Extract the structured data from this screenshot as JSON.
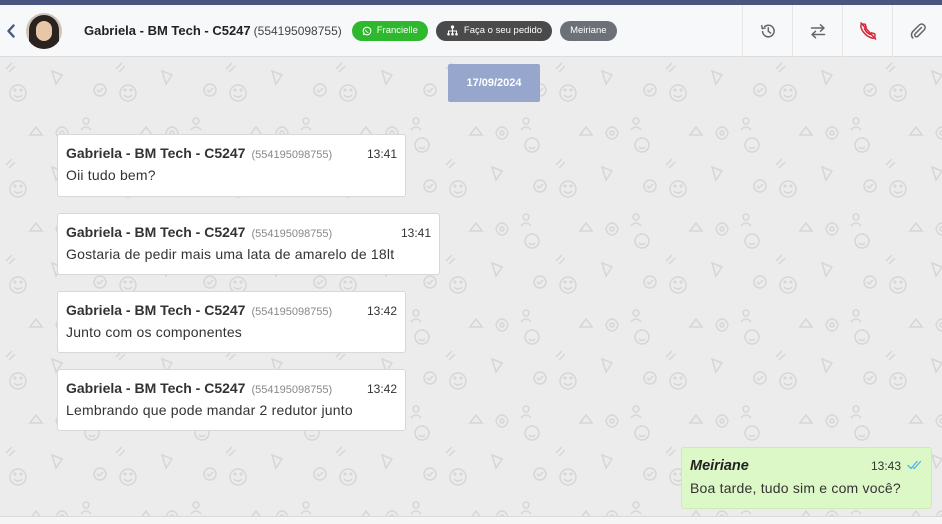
{
  "header": {
    "contact_name": "Gabriela - BM Tech - C5247",
    "contact_phone": "(554195098755)",
    "tags": [
      {
        "label": "Francielle",
        "icon": "whatsapp-icon",
        "color": "#2eb82e"
      },
      {
        "label": "Faça o seu pedido",
        "icon": "network-icon",
        "color": "#4a4a4a"
      },
      {
        "label": "Meiriane",
        "color": "#6c7077"
      }
    ],
    "actions": [
      "history-icon",
      "transfer-icon",
      "end-call-icon",
      "attach-icon"
    ]
  },
  "chat": {
    "date": "17/09/2024",
    "incoming": [
      {
        "sender": "Gabriela - BM Tech - C5247",
        "phone": "(554195098755)",
        "time": "13:41",
        "text": "Oii tudo bem?"
      },
      {
        "sender": "Gabriela - BM Tech - C5247",
        "phone": "(554195098755)",
        "time": "13:41",
        "text": "Gostaria de pedir mais uma lata de amarelo de 18lt"
      },
      {
        "sender": "Gabriela - BM Tech - C5247",
        "phone": "(554195098755)",
        "time": "13:42",
        "text": "Junto com os componentes"
      },
      {
        "sender": "Gabriela - BM Tech - C5247",
        "phone": "(554195098755)",
        "time": "13:42",
        "text": "Lembrando que pode mandar 2 redutor junto"
      }
    ],
    "outgoing": {
      "sender": "Meiriane",
      "time": "13:43",
      "text": "Boa tarde, tudo sim e com você?",
      "status_icon": "double-check-icon"
    }
  },
  "colors": {
    "accent": "#4a5580",
    "date_chip": "#97a6cc",
    "outgoing_bubble": "#dcf8c6",
    "end_call": "#d9283a"
  }
}
